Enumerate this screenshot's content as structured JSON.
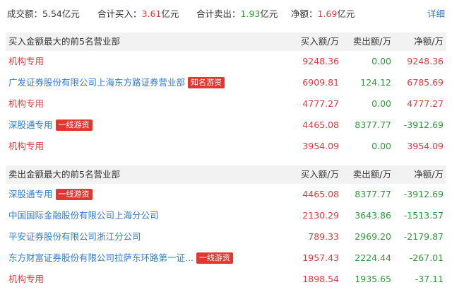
{
  "summary": {
    "turnover_label": "成交额：",
    "turnover_value": "5.54",
    "turnover_unit": "亿元",
    "total_buy_label": "合计买入：",
    "total_buy_value": "3.61",
    "total_buy_unit": "亿元",
    "total_sell_label": "合计卖出：",
    "total_sell_value": "1.93",
    "total_sell_unit": "亿元",
    "net_label": "净额：",
    "net_value": "1.69",
    "net_unit": "亿元",
    "detail_link": "详细"
  },
  "chart_data": {
    "type": "table",
    "tables": [
      {
        "title": "买入金额最大的前5名营业部",
        "columns": [
          "买入额/万",
          "卖出额/万",
          "净额/万"
        ],
        "rows": [
          {
            "name": "机构专用",
            "name_color": "red",
            "badge": "",
            "buy": "9248.36",
            "sell": "0.00",
            "net": "9248.36",
            "net_sign": "pos"
          },
          {
            "name": "广发证券股份有限公司上海东方路证券营业部",
            "name_color": "blue",
            "badge": "知名游资",
            "buy": "6909.81",
            "sell": "124.12",
            "net": "6785.69",
            "net_sign": "pos"
          },
          {
            "name": "机构专用",
            "name_color": "red",
            "badge": "",
            "buy": "4777.27",
            "sell": "0.00",
            "net": "4777.27",
            "net_sign": "pos"
          },
          {
            "name": "深股通专用",
            "name_color": "blue",
            "badge": "一线游资",
            "buy": "4465.08",
            "sell": "8377.77",
            "net": "-3912.69",
            "net_sign": "neg"
          },
          {
            "name": "机构专用",
            "name_color": "red",
            "badge": "",
            "buy": "3954.09",
            "sell": "0.00",
            "net": "3954.09",
            "net_sign": "pos"
          }
        ]
      },
      {
        "title": "卖出金额最大的前5名营业部",
        "columns": [
          "买入额/万",
          "卖出额/万",
          "净额/万"
        ],
        "rows": [
          {
            "name": "深股通专用",
            "name_color": "blue",
            "badge": "一线游资",
            "buy": "4465.08",
            "sell": "8377.77",
            "net": "-3912.69",
            "net_sign": "neg"
          },
          {
            "name": "中国国际金融股份有限公司上海分公司",
            "name_color": "blue",
            "badge": "",
            "buy": "2130.29",
            "sell": "3643.86",
            "net": "-1513.57",
            "net_sign": "neg"
          },
          {
            "name": "平安证券股份有限公司浙江分公司",
            "name_color": "blue",
            "badge": "",
            "buy": "789.33",
            "sell": "2969.20",
            "net": "-2179.87",
            "net_sign": "neg"
          },
          {
            "name": "东方财富证券股份有限公司拉萨东环路第一证...",
            "name_color": "blue",
            "badge": "一线游资",
            "buy": "1957.43",
            "sell": "2224.44",
            "net": "-267.01",
            "net_sign": "neg"
          },
          {
            "name": "机构专用",
            "name_color": "red",
            "badge": "",
            "buy": "1898.54",
            "sell": "1935.65",
            "net": "-37.11",
            "net_sign": "neg"
          }
        ]
      }
    ]
  }
}
